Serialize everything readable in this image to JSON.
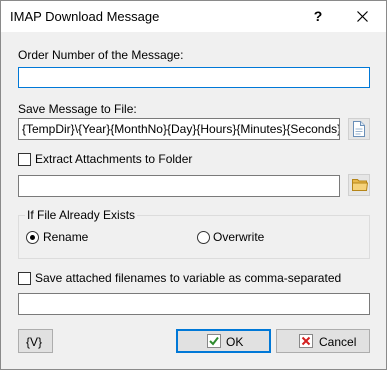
{
  "window": {
    "title": "IMAP Download Message",
    "help_glyph": "?",
    "close_icon": "close-icon"
  },
  "order": {
    "label": "Order Number of the Message:",
    "value": ""
  },
  "save": {
    "label": "Save Message to File:",
    "value": "{TempDir}\\{Year}{MonthNo}{Day}{Hours}{Minutes}{Seconds}{ms}",
    "browse_icon": "file-icon"
  },
  "extract": {
    "label": "Extract Attachments to Folder",
    "checked": false,
    "value": "",
    "browse_icon": "folder-icon"
  },
  "exists": {
    "group_title": "If File Already Exists",
    "options": [
      "Rename",
      "Overwrite"
    ],
    "selected": "Rename"
  },
  "attached": {
    "label": "Save attached filenames to variable as comma-separated",
    "checked": false,
    "value": ""
  },
  "buttons": {
    "variables": "{V}",
    "ok": "OK",
    "cancel": "Cancel"
  },
  "colors": {
    "accent": "#0078d7",
    "ok_check": "#2e8b2e",
    "cancel_x": "#d32020"
  }
}
